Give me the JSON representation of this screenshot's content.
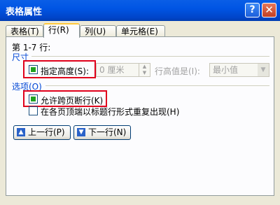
{
  "window": {
    "title": "表格属性"
  },
  "title_buttons": {
    "help": "?",
    "close": "✕"
  },
  "tabs": [
    {
      "label": "表格(T)",
      "active": false
    },
    {
      "label": "行(R)",
      "active": true
    },
    {
      "label": "列(U)",
      "active": false
    },
    {
      "label": "单元格(E)",
      "active": false
    }
  ],
  "rows_label": "第 1-7 行:",
  "size_section": {
    "label": "尺寸",
    "specify_height": {
      "label": "指定高度(S):",
      "checked": true
    },
    "height_value": "0 厘米",
    "row_height_label": "行高值是(I):",
    "row_height_option": "最小值"
  },
  "options_section": {
    "label": "选项(O)",
    "allow_break": {
      "label": "允许跨页断行(K)",
      "checked": true
    },
    "repeat_header": {
      "label": "在各页顶端以标题行形式重复出现(H)",
      "checked": false
    }
  },
  "nav": {
    "prev": "上一行(P)",
    "next": "下一行(N)"
  },
  "colors": {
    "highlight": "#e0001b",
    "accent": "#0046d5",
    "title_bar": "#0055e4"
  }
}
